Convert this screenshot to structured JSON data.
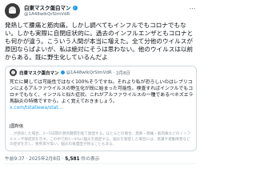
{
  "author": {
    "display_name": "白東マスク蛋白マン",
    "handle": "@1A48wIkQrSImVdR"
  },
  "more_label": "…",
  "post": {
    "text": "発熱して腰痛と筋肉痛。しかし調べてもインフルでもコロナでもない。しかも実際に自閉症状的に。過去のインフルエンザともコロナとも何かが違う。こういう人間が本当に増えた。全て分他のウイルスが原因ならばよいが、私は絶対にそうは思わない。他のウイルスは以前からある。既に野生化しているんだよ"
  },
  "quote": {
    "display_name": "白東マスク蛋白マン",
    "handle": "@1A48wIkQrSImVdR",
    "date": "2月8日",
    "text": "死亡に関しては可能性ではなく100%そうですね。それより私が恐ろしいのはレプリコンによるアルファウイルスの野生化が既に始まった可能性。検査すればインフルでもコロナでもなく、インフルと似た症状。これがアルファウイルスの一種であるベネズエラ馬脳炎の特徴ですから。よく覚えておきましょう。",
    "link": "x.com/tstatiewa/stat...",
    "section_label": "J国所信",
    "faded_text": "…が感染した場合、2〜5日間の潜伏期間を経て発症する。ほとんどの場合、発熱・頭痛・筋肉痛などのインフルエンザ様症状を示す。この中で約1〜4%に脳炎を発症する。脳炎を発症した場合には、意識や運動障害などの症状を示し、致死率が高い。脳炎の後遺症が残ることもある。"
  },
  "meta": {
    "time": "午前9:37",
    "date": "2025年2月8日",
    "views_count": "5,581",
    "views_label": "件の表示"
  }
}
